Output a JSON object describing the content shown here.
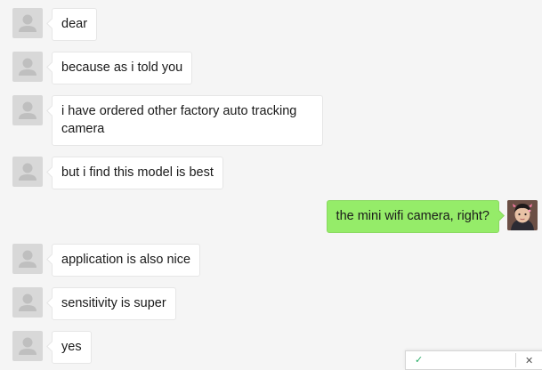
{
  "messages": [
    {
      "from": "contact",
      "text": "dear"
    },
    {
      "from": "contact",
      "text": "because as i told you"
    },
    {
      "from": "contact",
      "text": "i have ordered other factory auto tracking camera"
    },
    {
      "from": "contact",
      "text": "but i find this model is best"
    },
    {
      "from": "self",
      "text": "the mini wifi camera, right?"
    },
    {
      "from": "contact",
      "text": "application is also nice"
    },
    {
      "from": "contact",
      "text": "sensitivity is super"
    },
    {
      "from": "contact",
      "text": "yes"
    }
  ],
  "icons": {
    "contact_avatar": "default-user-avatar-icon",
    "self_avatar": "user-photo-avatar",
    "popup_close": "close-icon"
  },
  "colors": {
    "background": "#f5f5f5",
    "incoming_bubble": "#ffffff",
    "outgoing_bubble": "#95ec69",
    "avatar_placeholder": "#d8d8d8"
  }
}
